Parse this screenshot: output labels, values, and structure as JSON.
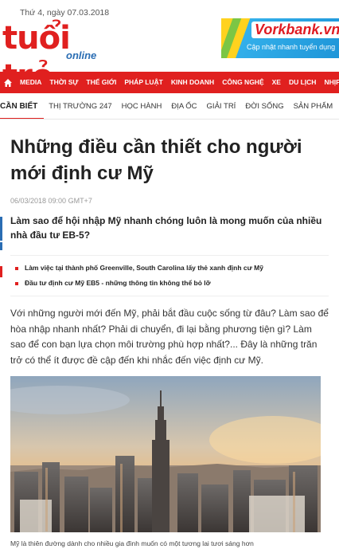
{
  "header": {
    "date": "Thứ 4, ngày 07.03.2018",
    "logo_main": "tuổi trẻ",
    "logo_sub": "online"
  },
  "ad": {
    "brand": "Vorkbank.vn",
    "tagline": "Cập nhật nhanh tuyển dụng"
  },
  "nav": {
    "items": [
      "MEDIA",
      "THỜI SỰ",
      "THẾ GIỚI",
      "PHÁP LUẬT",
      "KINH DOANH",
      "CÔNG NGHỆ",
      "XE",
      "DU LỊCH",
      "NHỊP SỐNG TRẺ"
    ]
  },
  "subnav": {
    "active": "CẦN BIẾT",
    "items": [
      "THỊ TRƯỜNG 247",
      "HỌC HÀNH",
      "ĐỊA ỐC",
      "GIẢI TRÍ",
      "ĐỜI SỐNG",
      "SẢN PHẨM"
    ]
  },
  "article": {
    "title": "Những điều cần thiết cho người mới định cư Mỹ",
    "meta": "06/03/2018 09:00 GMT+7",
    "sapo": "Làm sao để hội nhập Mỹ nhanh chóng luôn là mong muốn của nhiều nhà đầu tư EB-5?",
    "related": [
      "Làm việc tại thành phố Greenville, South Carolina lấy thẻ xanh định cư Mỹ",
      "Đầu tư định cư Mỹ EB5 - những thông tin không thể bỏ lỡ"
    ],
    "body": "Với những người mới đến Mỹ, phải bắt đầu cuộc sống từ đâu? Làm sao để hòa nhập nhanh nhất? Phải di chuyển, đi lại bằng phương tiện gì? Làm sao để con bạn lựa chọn môi trường phù hợp nhất?... Đây là những trăn trở có thể ít được đề cập đến khi nhắc đến việc định cư Mỹ.",
    "caption": "Mỹ là thiên đường dành cho nhiều gia đình muốn có một tương lai tươi sáng hơn"
  },
  "colors": {
    "brand_red": "#e0201f",
    "accent_blue": "#2a6db3"
  }
}
